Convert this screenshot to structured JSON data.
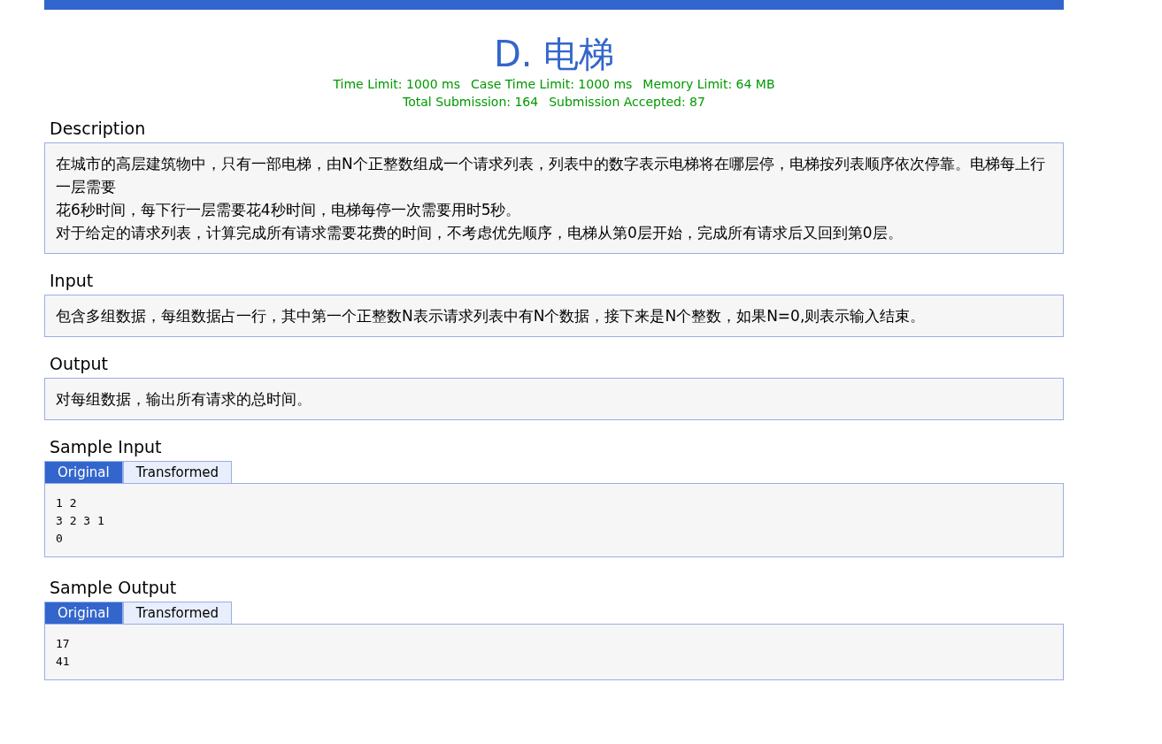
{
  "title": "D. 电梯",
  "limits": [
    "Time Limit: 1000 ms",
    "Case Time Limit: 1000 ms",
    "Memory Limit: 64 MB"
  ],
  "stats": [
    "Total Submission: 164",
    "Submission Accepted: 87"
  ],
  "sections": [
    {
      "kind": "text",
      "heading": "Description",
      "lines": [
        "在城市的高层建筑物中，只有一部电梯，由N个正整数组成一个请求列表，列表中的数字表示电梯将在哪层停，电梯按列表顺序依次停靠。电梯每上行一层需要",
        "花6秒时间，每下行一层需要花4秒时间，电梯每停一次需要用时5秒。",
        "对于给定的请求列表，计算完成所有请求需要花费的时间，不考虑优先顺序，电梯从第0层开始，完成所有请求后又回到第0层。"
      ]
    },
    {
      "kind": "text",
      "heading": "Input",
      "lines": [
        "包含多组数据，每组数据占一行，其中第一个正整数N表示请求列表中有N个数据，接下来是N个整数，如果N=0,则表示输入结束。"
      ]
    },
    {
      "kind": "text",
      "heading": "Output",
      "lines": [
        "对每组数据，输出所有请求的总时间。"
      ]
    },
    {
      "kind": "code",
      "heading": "Sample Input",
      "tabs": [
        {
          "label": "Original",
          "selected": true
        },
        {
          "label": "Transformed",
          "selected": false
        }
      ],
      "lines": [
        "1 2",
        "3 2 3 1",
        "0"
      ]
    },
    {
      "kind": "code",
      "heading": "Sample Output",
      "tabs": [
        {
          "label": "Original",
          "selected": true
        },
        {
          "label": "Transformed",
          "selected": false
        }
      ],
      "lines": [
        "17",
        "41"
      ]
    }
  ]
}
